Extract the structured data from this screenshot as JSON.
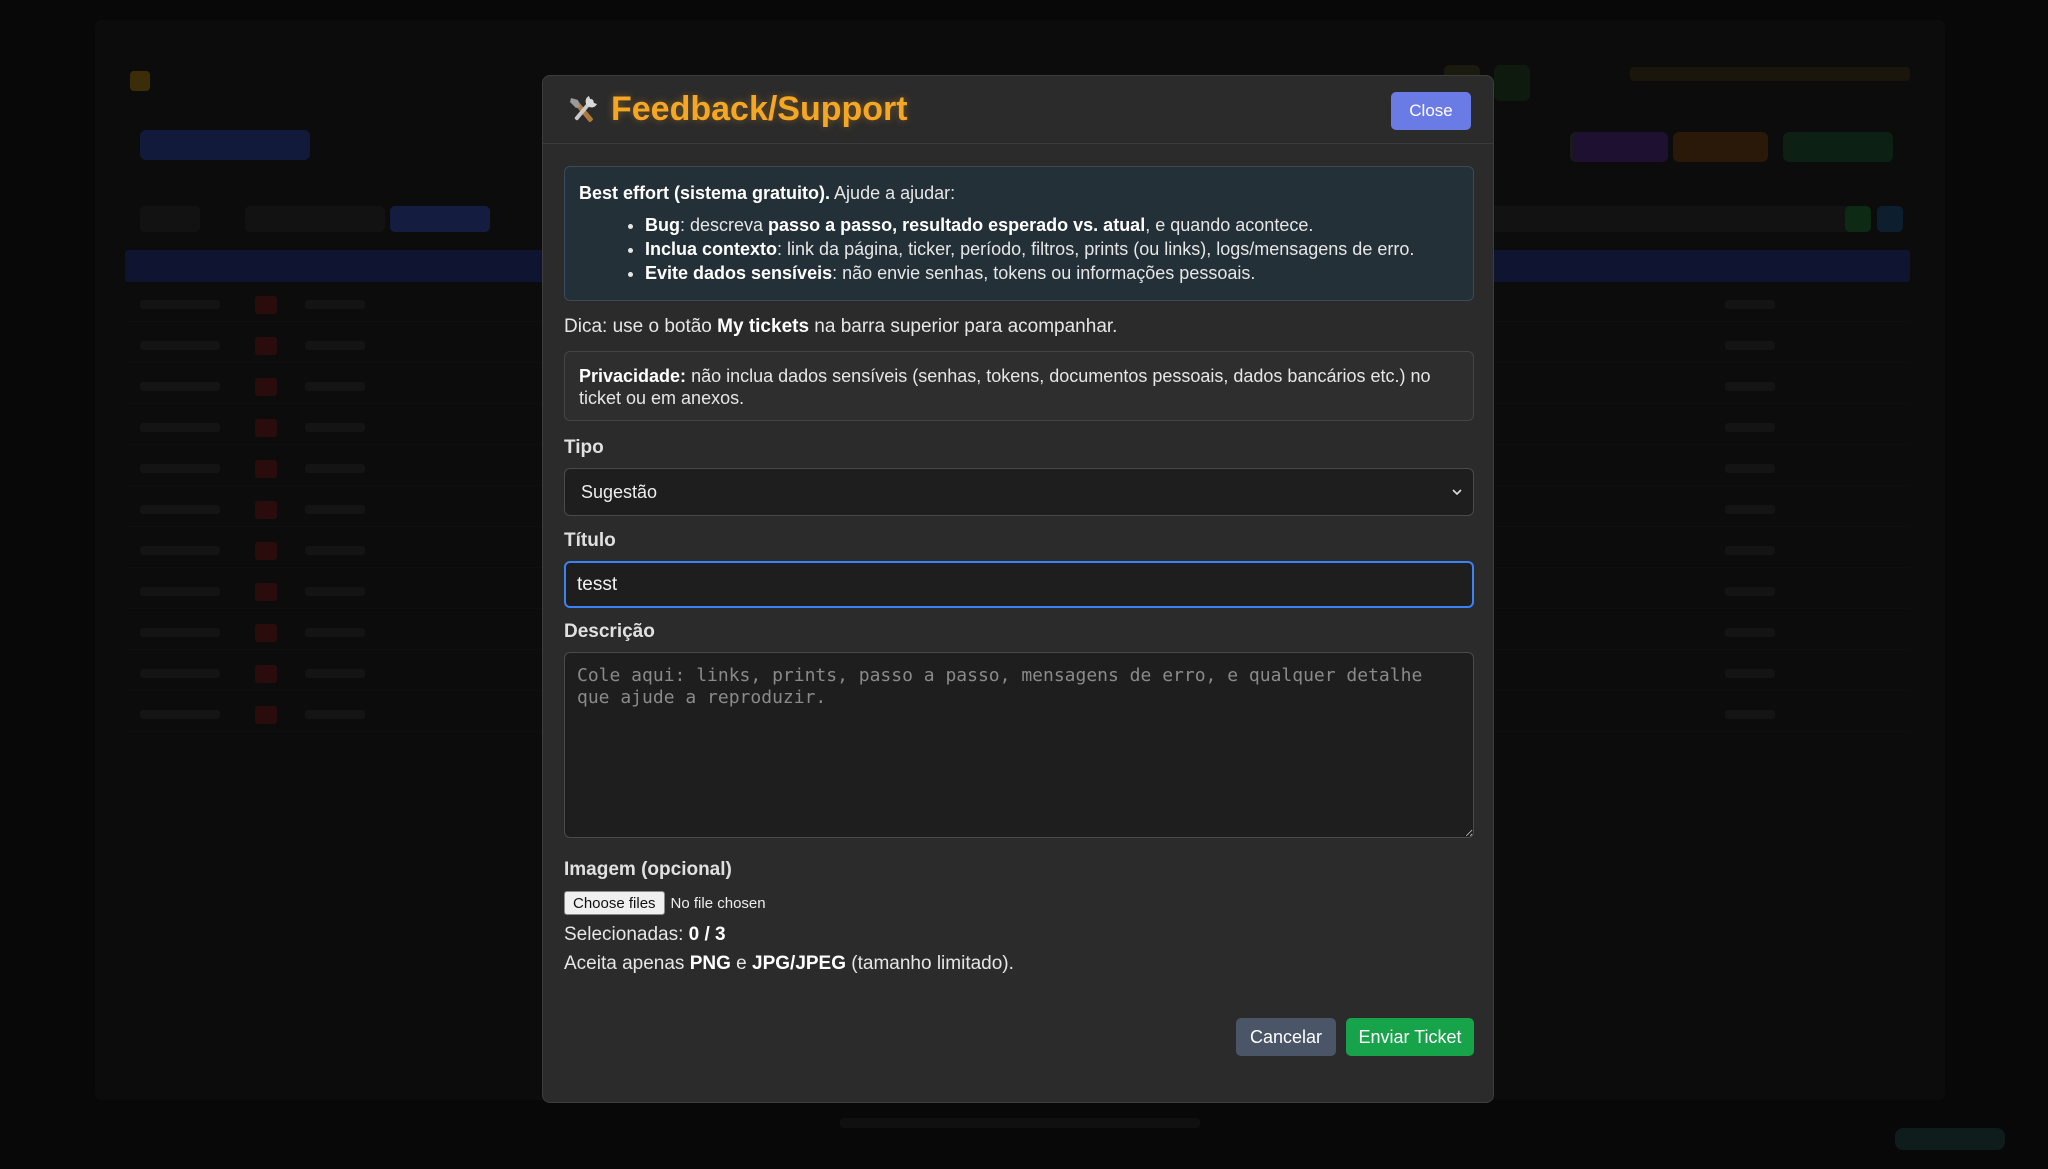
{
  "modal": {
    "title": "Feedback/Support",
    "close_label": "Close",
    "title_icon": "tools-icon",
    "accent_color": "#f5a623"
  },
  "info": {
    "lead_bold": "Best effort (sistema gratuito).",
    "lead_text": " Ajude a ajudar:",
    "bullets": [
      {
        "b1": "Bug",
        "t1": ": descreva ",
        "b2": "passo a passo, resultado esperado vs. atual",
        "t2": ", e quando acontece."
      },
      {
        "b1": "Inclua contexto",
        "t1": ": link da página, ticker, período, filtros, prints (ou links), logs/mensagens de erro."
      },
      {
        "b1": "Evite dados sensíveis",
        "t1": ": não envie senhas, tokens ou informações pessoais."
      }
    ]
  },
  "tip": {
    "prefix": "Dica: use o botão ",
    "bold": "My tickets",
    "suffix": " na barra superior para acompanhar."
  },
  "privacy": {
    "bold": "Privacidade:",
    "text": " não inclua dados sensíveis (senhas, tokens, documentos pessoais, dados bancários etc.) no ticket ou em anexos."
  },
  "form": {
    "tipo_label": "Tipo",
    "tipo_value": "Sugestão",
    "titulo_label": "Título",
    "titulo_value": "tesst",
    "descricao_label": "Descrição",
    "descricao_placeholder": "Cole aqui: links, prints, passo a passo, mensagens de erro, e qualquer detalhe que ajude a reproduzir.",
    "imagem_label": "Imagem (opcional)",
    "file_button": "Choose files",
    "file_status": "No file chosen",
    "selected_prefix": "Selecionadas: ",
    "selected_count": "0 / 3",
    "accept_prefix": "Aceita apenas ",
    "accept_png": "PNG",
    "accept_and": " e ",
    "accept_jpg": "JPG/JPEG",
    "accept_suffix": " (tamanho limitado)."
  },
  "actions": {
    "cancel_label": "Cancelar",
    "send_label": "Enviar Ticket",
    "cancel_color": "#4a5568",
    "send_color": "#16a34a"
  }
}
